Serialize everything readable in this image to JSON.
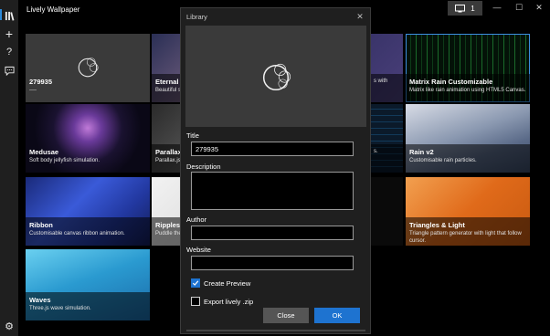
{
  "app": {
    "title": "Lively Wallpaper"
  },
  "titlebar": {
    "monitor_count": "1",
    "minimize": "—",
    "maximize": "☐",
    "close": "✕"
  },
  "sidebar": {
    "items": [
      {
        "name": "library-icon"
      },
      {
        "name": "add-icon",
        "glyph": "+"
      },
      {
        "name": "help-icon",
        "glyph": "?"
      },
      {
        "name": "feedback-icon"
      },
      {
        "name": "settings-icon",
        "glyph": "⚙"
      }
    ]
  },
  "tiles": [
    {
      "title": "279935",
      "desc": "----"
    },
    {
      "title": "Eternal Li",
      "desc": "Beautiful s"
    },
    {
      "title": "",
      "desc": "s with"
    },
    {
      "title": "Matrix Rain Customizable",
      "desc": "Matrix like rain animation using HTML5 Canvas."
    },
    {
      "title": "Medusae",
      "desc": "Soft body jellyfish simulation."
    },
    {
      "title": "Parallax.js",
      "desc": "Parallax.js"
    },
    {
      "title": "",
      "desc": "s."
    },
    {
      "title": "Rain v2",
      "desc": "Customisable rain particles."
    },
    {
      "title": "Ribbon",
      "desc": "Customisable canvas ribbon animation."
    },
    {
      "title": "Ripples",
      "desc": "Puddle the"
    },
    {
      "title": "",
      "desc": ""
    },
    {
      "title": "Triangles & Light",
      "desc": "Triangle pattern generator with light that follow cursor."
    },
    {
      "title": "Waves",
      "desc": "Three.js wave simulation."
    }
  ],
  "dialog": {
    "title": "Library",
    "close": "✕",
    "title_label": "Title",
    "title_value": "279935",
    "description_label": "Description",
    "description_value": "",
    "author_label": "Author",
    "author_value": "",
    "website_label": "Website",
    "website_value": "",
    "create_preview_label": "Create Preview",
    "create_preview_checked": true,
    "export_label": "Export lively .zip",
    "export_checked": false,
    "close_button": "Close",
    "ok_button": "OK"
  },
  "colors": {
    "accent": "#1e73d0",
    "selection": "#3c8ee0",
    "dialog_bg": "#1f1f1f"
  }
}
